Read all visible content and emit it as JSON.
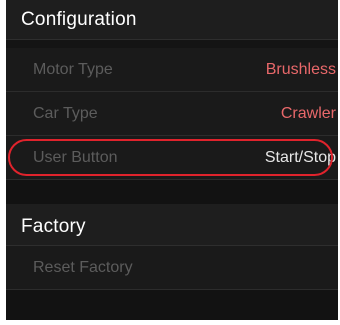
{
  "sections": [
    {
      "title": "Configuration",
      "items": [
        {
          "label": "Motor Type",
          "value": "Brushless"
        },
        {
          "label": "Car Type",
          "value": "Crawler"
        },
        {
          "label": "User Button",
          "value": "Start/Stop"
        }
      ]
    },
    {
      "title": "Factory",
      "items": [
        {
          "label": "Reset Factory"
        }
      ]
    }
  ],
  "colors": {
    "value_text": "#e8686a",
    "user_button_value": "#e6e6e6",
    "highlight": "#e0232c"
  }
}
